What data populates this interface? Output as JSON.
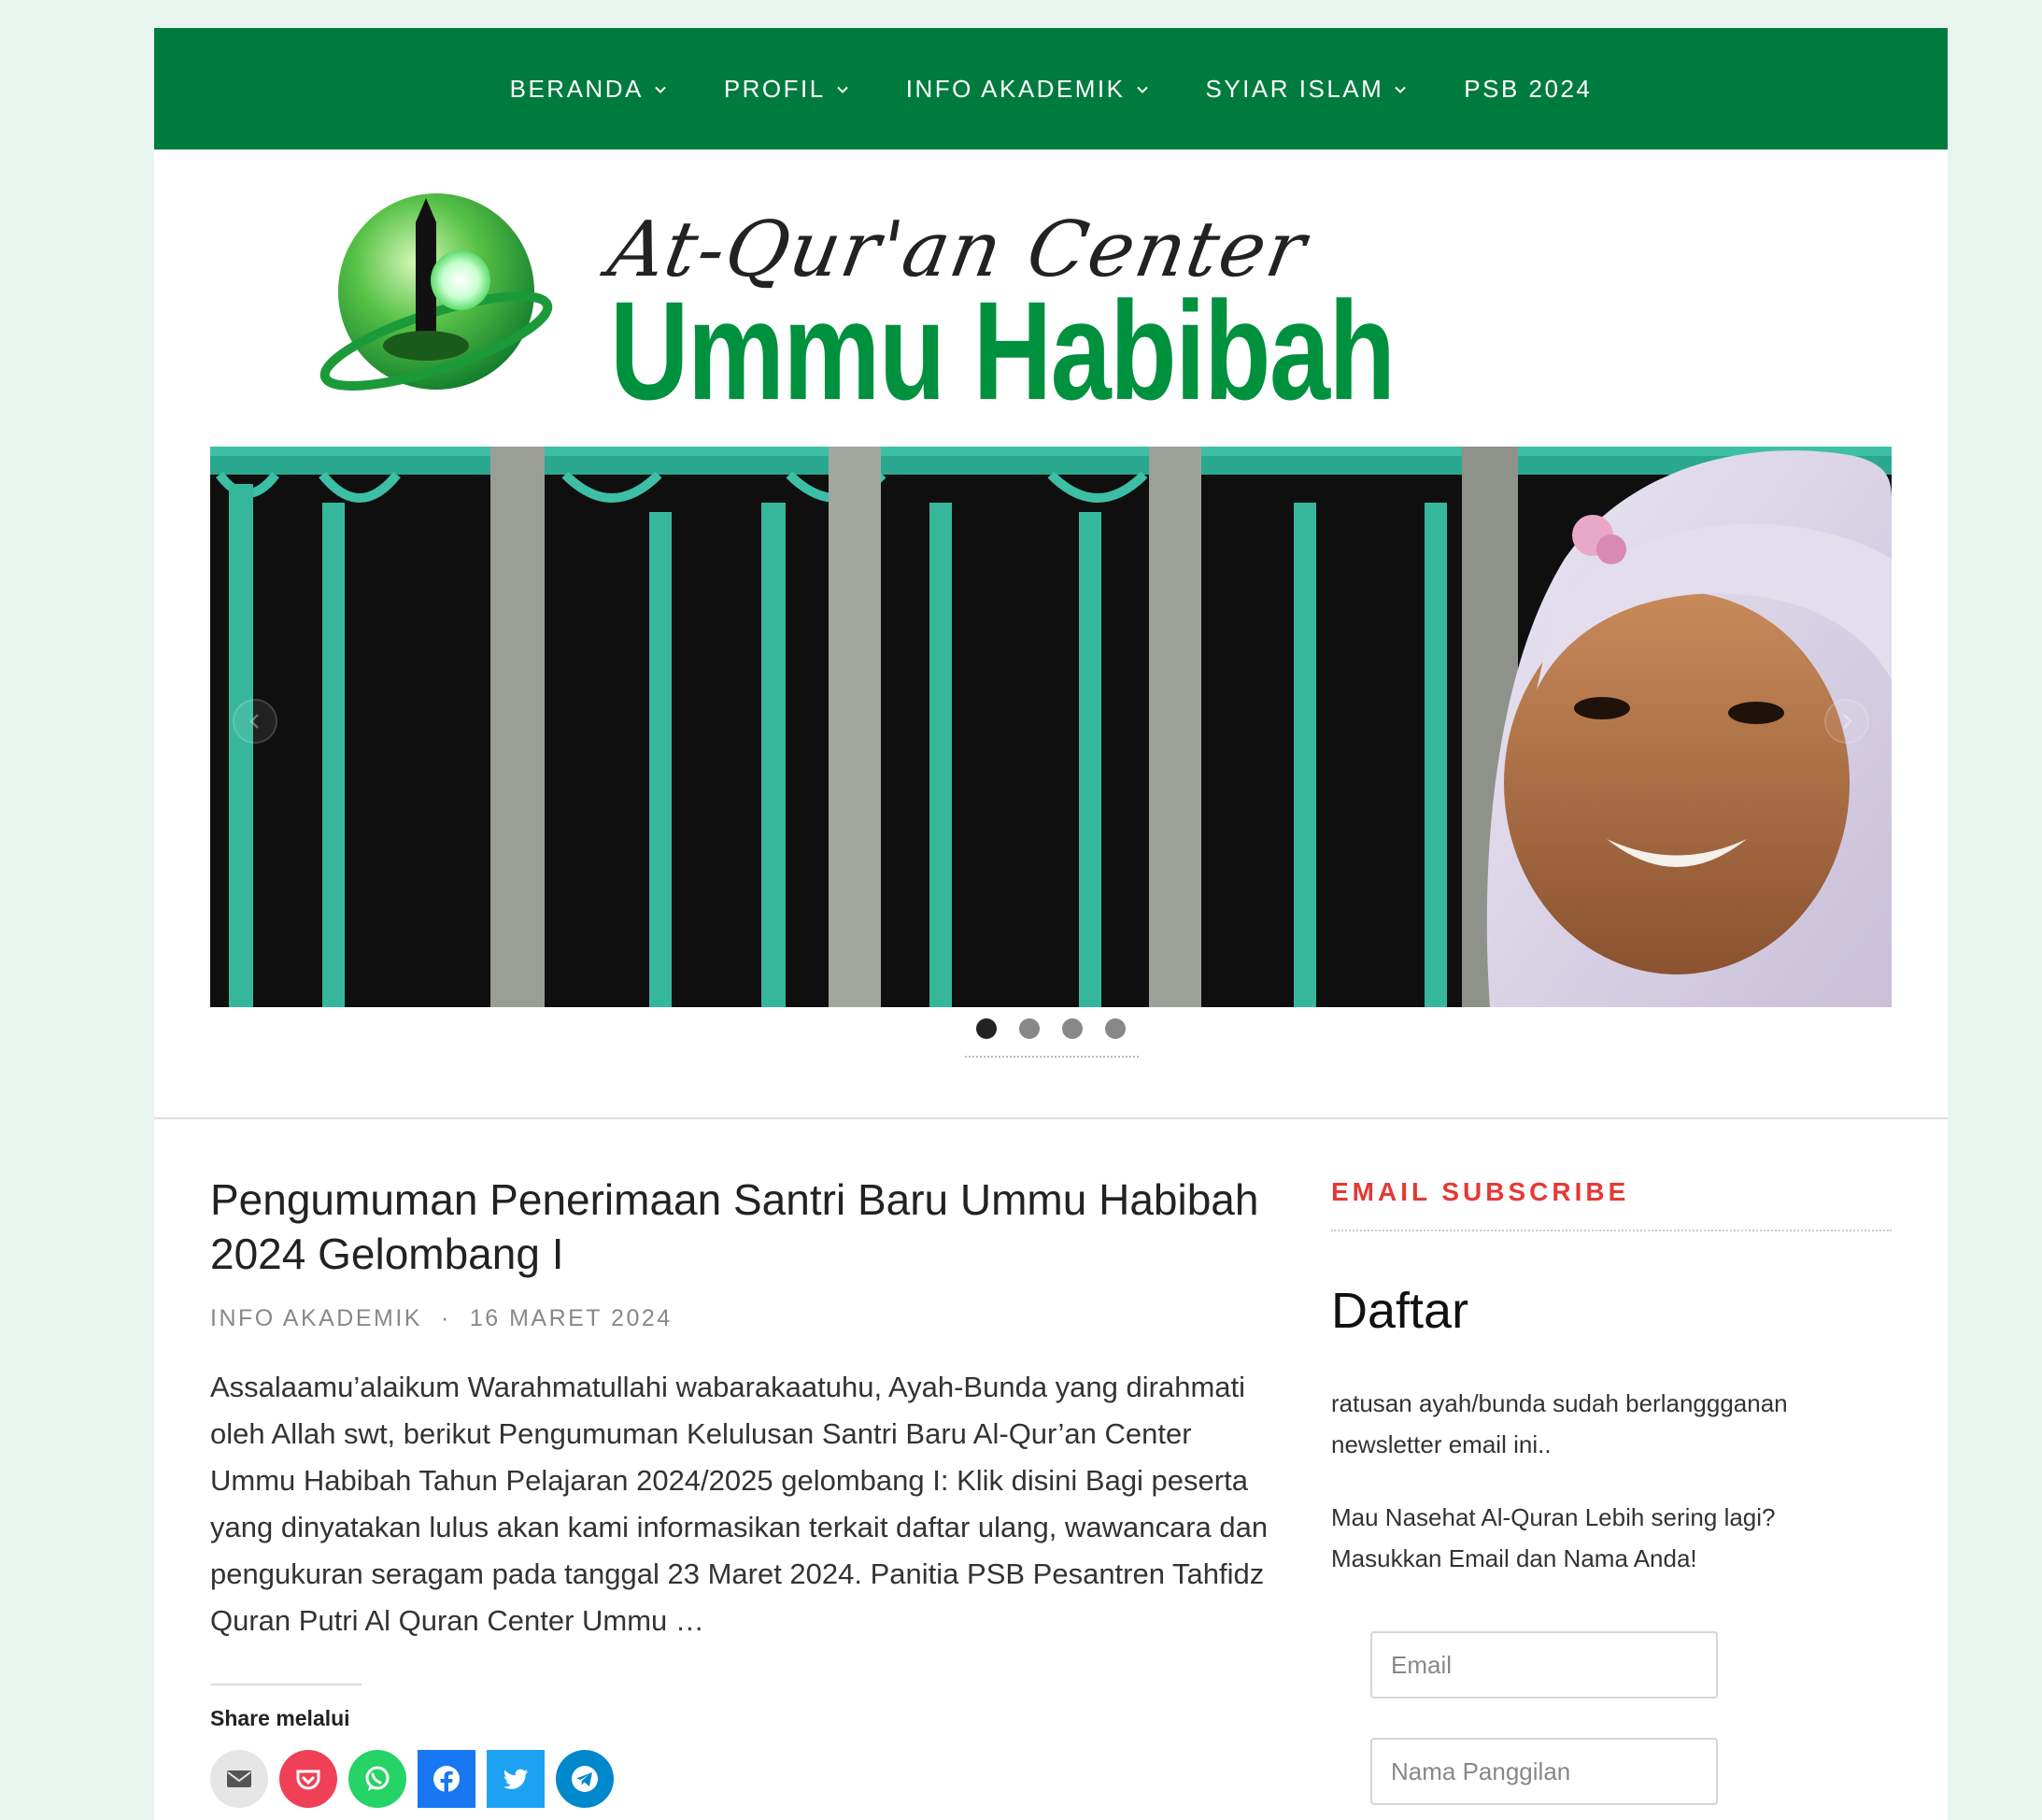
{
  "nav": {
    "items": [
      {
        "label": "BERANDA",
        "dropdown": true
      },
      {
        "label": "PROFIL",
        "dropdown": true
      },
      {
        "label": "INFO AKADEMIK",
        "dropdown": true
      },
      {
        "label": "SYIAR ISLAM",
        "dropdown": true
      },
      {
        "label": "PSB 2024",
        "dropdown": false
      }
    ]
  },
  "logo": {
    "script_text": "At-Qur'an Center",
    "brand_text": "Ummu Habibah",
    "icon": "mosque-globe-emblem"
  },
  "slider": {
    "slide_count": 4,
    "active_index": 0,
    "prev_icon": "chevron-left-icon",
    "next_icon": "chevron-right-icon"
  },
  "post": {
    "title": "Pengumuman Penerimaan Santri Baru Ummu Habibah 2024 Gelombang I",
    "category": "INFO AKADEMIK",
    "separator": "·",
    "date": "16 MARET 2024",
    "excerpt": "Assalaamu’alaikum Warahmatullahi wabarakaatuhu, Ayah-Bunda yang dirahmati oleh Allah swt, berikut Pengumuman Kelulusan Santri Baru Al-Qur’an Center Ummu Habibah Tahun Pelajaran 2024/2025 gelombang I: Klik disini Bagi peserta yang dinyatakan lulus akan kami informasikan terkait daftar ulang, wawancara dan pengukuran seragam pada tanggal 23 Maret 2024. Panitia PSB Pesantren Tahfidz Quran Putri Al Quran Center Ummu …",
    "share_label": "Share melalui",
    "share_buttons": [
      {
        "name": "email",
        "icon": "email-icon",
        "color": "#e6e6e6"
      },
      {
        "name": "pocket",
        "icon": "pocket-icon",
        "color": "#ef4056"
      },
      {
        "name": "whatsapp",
        "icon": "whatsapp-icon",
        "color": "#25d366"
      },
      {
        "name": "facebook",
        "icon": "facebook-icon",
        "color": "#1877f2"
      },
      {
        "name": "twitter",
        "icon": "twitter-icon",
        "color": "#1da1f2"
      },
      {
        "name": "telegram",
        "icon": "telegram-icon",
        "color": "#0088cc"
      }
    ]
  },
  "sidebar": {
    "widget_title": "EMAIL SUBSCRIBE",
    "heading": "Daftar",
    "text_1": "ratusan ayah/bunda sudah berlanggganan newsletter email ini..",
    "text_2": "Mau Nasehat Al-Quran Lebih sering lagi? Masukkan Email dan Nama Anda!",
    "email_placeholder": "Email",
    "name_placeholder": "Nama Panggilan"
  },
  "colors": {
    "nav_bg": "#007b3e",
    "brand_green": "#00913f",
    "widget_title": "#e53935",
    "page_bg": "#e8f5ee"
  }
}
